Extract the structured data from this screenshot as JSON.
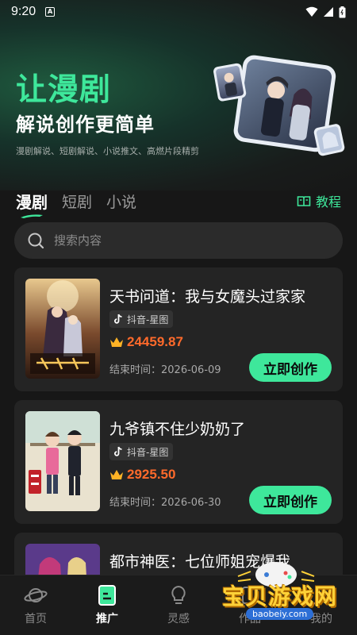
{
  "status_bar": {
    "time": "9:20"
  },
  "hero": {
    "title": "让漫剧",
    "subtitle": "解说创作更简单",
    "description": "漫剧解说、短剧解说、小说推文、高燃片段精剪"
  },
  "tabs": [
    {
      "label": "漫剧",
      "active": true
    },
    {
      "label": "短剧",
      "active": false
    },
    {
      "label": "小说",
      "active": false
    }
  ],
  "tutorial_label": "教程",
  "search": {
    "placeholder": "搜索内容"
  },
  "cards": [
    {
      "title": "天书问道：我与女魔头过家家",
      "platform": "抖音-星图",
      "reward": "24459.87",
      "end_time": "结束时间：2026-06-09",
      "button": "立即创作"
    },
    {
      "title": "九爷镇不住少奶奶了",
      "platform": "抖音-星图",
      "reward": "2925.50",
      "end_time": "结束时间：2026-06-30",
      "button": "立即创作"
    },
    {
      "title": "都市神医：七位师姐宠爆我"
    }
  ],
  "bottom_nav": [
    {
      "label": "首页",
      "icon": "planet-icon"
    },
    {
      "label": "推广",
      "icon": "document-icon"
    },
    {
      "label": "灵感",
      "icon": "lightbulb-icon"
    },
    {
      "label": "作品",
      "icon": "works-icon"
    },
    {
      "label": "我的",
      "icon": "profile-icon"
    }
  ],
  "watermark": {
    "name": "宝贝游戏网",
    "url": "baobeiy.com"
  },
  "colors": {
    "accent": "#3ee79b",
    "reward": "#ff6a2b",
    "background": "#171717",
    "card": "#242424"
  }
}
